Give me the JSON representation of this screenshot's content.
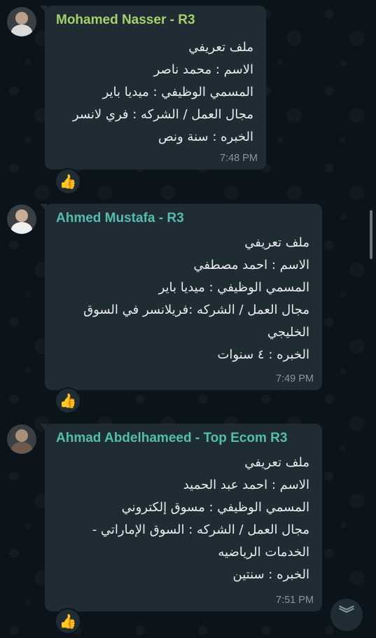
{
  "messages": [
    {
      "sender": "Mohamed Nasser - R3",
      "sender_color": "#a5d16b",
      "lines": [
        "ملف تعريفي",
        "الاسم : محمد ناصر",
        "المسمي الوظيفي : ميديا باير",
        "مجال العمل / الشركه : فري لانسر",
        "الخبره : سنة ونص"
      ],
      "time": "7:48 PM",
      "reaction": "👍"
    },
    {
      "sender": "Ahmed Mustafa - R3",
      "sender_color": "#53bdae",
      "lines": [
        "ملف تعريفي",
        "الاسم :  احمد مصطفي",
        "المسمي الوظيفي : ميديا باير",
        "مجال العمل / الشركه :فريلانسر في السوق",
        "الخليجي",
        "الخبره : ٤ سنوات"
      ],
      "time": "7:49 PM",
      "reaction": "👍"
    },
    {
      "sender": "Ahmad Abdelhameed - Top Ecom R3",
      "sender_color": "#53bdae",
      "lines": [
        "ملف تعريفي",
        "الاسم :  احمد عبد الحميد",
        "المسمي الوظيفي : مسوق إلكتروني",
        "مجال العمل / الشركه : السوق الإماراتي -",
        "الخدمات الرياضيه",
        "الخبره : سنتين"
      ],
      "time": "7:51 PM",
      "reaction": "👍"
    }
  ],
  "scroll_button_icon": "double-chevron-down-icon",
  "scroll_button_glyph": "︾"
}
